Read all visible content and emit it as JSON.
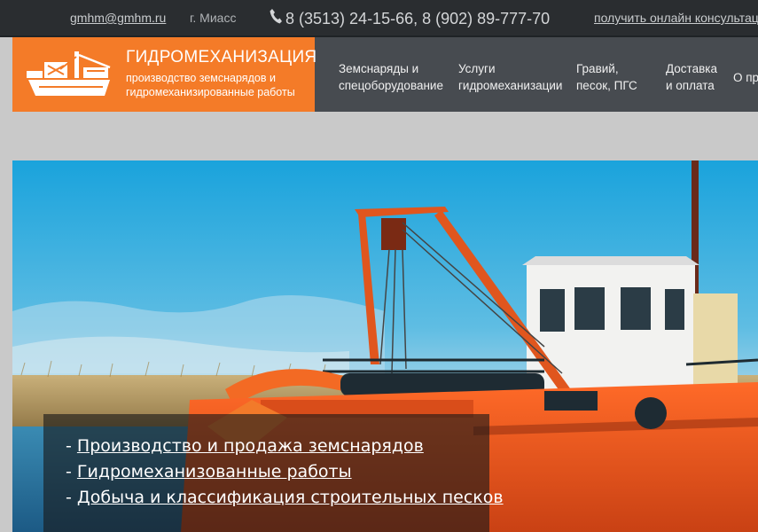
{
  "topbar": {
    "email": "gmhm@gmhm.ru",
    "city": "г. Миасс",
    "phone_icon": "phone-icon",
    "phones": "8 (3513) 24-15-66, 8 (902) 89-777-70",
    "consult_link": "получить онлайн консультац"
  },
  "logo": {
    "icon": "dredger-ship-icon",
    "brand": "ГИДРОМЕХАНИЗАЦИЯ",
    "tagline": "производство земснарядов и гидромеханизированные работы"
  },
  "nav": {
    "items": [
      {
        "line1": "Земснаряды и",
        "line2": "спецоборудование"
      },
      {
        "line1": "Услуги",
        "line2": "гидромеханизации"
      },
      {
        "line1": "Гравий,",
        "line2": "песок, ПГС"
      },
      {
        "line1": "Доставка",
        "line2": "и оплата"
      },
      {
        "line1": "О пр",
        "line2": ""
      }
    ]
  },
  "hero": {
    "lines": [
      {
        "prefix": "- ",
        "link": "Производство и продажа земснарядов"
      },
      {
        "prefix": "- ",
        "link": "Гидромеханизованные работы"
      },
      {
        "prefix": "- ",
        "link": "Добыча и классификация строительных песков"
      }
    ]
  },
  "colors": {
    "accent": "#f47b28",
    "topbar_bg": "#2a2d30",
    "nav_bg": "#474b50",
    "page_bg": "#c9c9c9"
  }
}
